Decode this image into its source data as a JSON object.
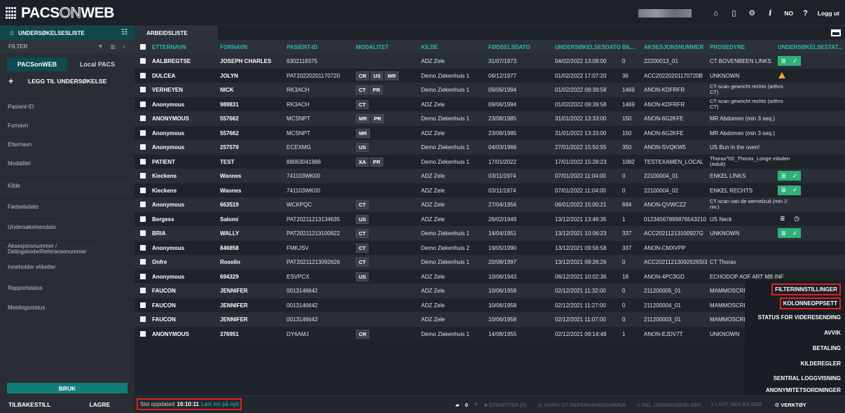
{
  "app": {
    "logo_prefix": "PACS",
    "logo_on": "ON",
    "logo_suffix": "WEB",
    "lang": "NO",
    "help": "?",
    "logout": "Logg ut"
  },
  "tabs": {
    "exam_list": "UNDERSØKELSESLISTE",
    "work_list": "ARBEIDSLISTE"
  },
  "sidebar": {
    "filter_title": "FILTER",
    "source_tabs": [
      "PACSonWEB",
      "Local PACS"
    ],
    "add_exam": "LEGG TIL UNDERSØKELSE",
    "fields": [
      "Pasient-ID",
      "Fornavn",
      "Etternavn",
      "Modalitet",
      "Kilde",
      "Fødselsdato",
      "Undersøkelsesdato",
      "Aksesjonsnummer / Delingskode/Referansenummer",
      "Inneholder etiketter",
      "Rapportstatus",
      "Meldingsstatus"
    ],
    "apply": "BRUK",
    "reset": "TILBAKESTILL",
    "save": "LAGRE"
  },
  "table": {
    "columns": [
      "ETTERNAVN",
      "FORNAVN",
      "PASIENT-ID",
      "MODALITET",
      "KILDE",
      "FØDSELSDATO",
      "UNDERSØKELSESDATO",
      "BIL...",
      "AKSESJONSNUMMER",
      "PROSEDYRE",
      "UNDERSØKELSESTAT..."
    ],
    "rows": [
      {
        "last": "AALBREGTSE",
        "first": "JOSEPH CHARLES",
        "pid": "6302118375",
        "mod": [],
        "src": "ADZ Zele",
        "dob": "31/07/1973",
        "date": "04/02/2022 13:08:00",
        "img": "0",
        "acc": "22200013_01",
        "proc": "CT BOVENBEEN LINKS",
        "status": "green"
      },
      {
        "last": "DULCEA",
        "first": "JOLYN",
        "pid": "PAT20220201170720",
        "mod": [
          "CR",
          "US",
          "MR"
        ],
        "src": "Demo Ziekenhuis 1",
        "dob": "06/12/1977",
        "date": "01/02/2022 17:07:20",
        "img": "36",
        "acc": "ACC20220201170720B",
        "proc": "UNKNOWN",
        "status": "warn"
      },
      {
        "last": "VERHEYEN",
        "first": "NICK",
        "pid": "RK3ACH",
        "mod": [
          "CT",
          "PR"
        ],
        "src": "Demo Ziekenhuis 1",
        "dob": "09/06/1994",
        "date": "01/02/2022 09:39:58",
        "img": "1469",
        "acc": "ANON-KDFRFR",
        "proc": "CT-scan gewricht rechts (arthro CT)",
        "status": ""
      },
      {
        "last": "Anonymous",
        "first": "989831",
        "pid": "RK3ACH",
        "mod": [
          "CT"
        ],
        "src": "ADZ Zele",
        "dob": "09/06/1994",
        "date": "01/02/2022 09:39:58",
        "img": "1469",
        "acc": "ANON-KDFRFR",
        "proc": "CT-scan gewricht rechts (arthro CT)",
        "status": ""
      },
      {
        "last": "ANONYMOUS",
        "first": "557662",
        "pid": "MCSNPT",
        "mod": [
          "MR",
          "PR"
        ],
        "src": "Demo Ziekenhuis 1",
        "dob": "23/08/1985",
        "date": "31/01/2022 13:33:00",
        "img": "150",
        "acc": "ANON-6G2KFE",
        "proc": "MR Abdomen (min 3 seq.)",
        "status": ""
      },
      {
        "last": "Anonymous",
        "first": "557662",
        "pid": "MCSNPT",
        "mod": [
          "MR"
        ],
        "src": "ADZ Zele",
        "dob": "23/08/1985",
        "date": "31/01/2022 13:33:00",
        "img": "150",
        "acc": "ANON-6G2KFE",
        "proc": "MR Abdomen (min 3 seq.)",
        "status": ""
      },
      {
        "last": "Anonymous",
        "first": "257579",
        "pid": "ECEXMG",
        "mod": [
          "US"
        ],
        "src": "Demo Ziekenhuis 1",
        "dob": "04/03/1966",
        "date": "27/01/2022 15:50:55",
        "img": "350",
        "acc": "ANON-SVQKW5",
        "proc": "US Bun in the oven!",
        "status": ""
      },
      {
        "last": "PATIENT",
        "first": "TEST",
        "pid": "88063041986",
        "mod": [
          "XA",
          "PR"
        ],
        "src": "Demo Ziekenhuis 1",
        "dob": "17/01/2022",
        "date": "17/01/2022 15:28:23",
        "img": "1082",
        "acc": "TESTEXAMEN_LOCAL",
        "proc": "Thorax^02_Thorax_Longe mbolen (Adult)",
        "status": ""
      },
      {
        "last": "Kieckens",
        "first": "Wannes",
        "pid": "741103WK00",
        "mod": [],
        "src": "ADZ Zele",
        "dob": "03/11/1974",
        "date": "07/01/2022 11:04:00",
        "img": "0",
        "acc": "22100004_01",
        "proc": "ENKEL LINKS",
        "status": "green"
      },
      {
        "last": "Kieckens",
        "first": "Wannes",
        "pid": "741103WK00",
        "mod": [],
        "src": "ADZ Zele",
        "dob": "03/11/1974",
        "date": "07/01/2022 11:04:00",
        "img": "0",
        "acc": "22100004_02",
        "proc": "ENKEL RECHTS",
        "status": "green"
      },
      {
        "last": "Anonymous",
        "first": "663519",
        "pid": "WCKPQC",
        "mod": [
          "CT"
        ],
        "src": "ADZ Zele",
        "dob": "27/04/1956",
        "date": "06/01/2022 15:00:21",
        "img": "694",
        "acc": "ANON-QVWCZZ",
        "proc": "CT-scan van de wervelzuil (min 2 niv.)",
        "status": ""
      },
      {
        "last": "Bergess",
        "first": "Salomi",
        "pid": "PAT20211213134635",
        "mod": [
          "US"
        ],
        "src": "ADZ Zele",
        "dob": "26/02/1949",
        "date": "13/12/2021 13:46:35",
        "img": "1",
        "acc": "01234567899876543210",
        "proc": "US Neck",
        "status": "gray"
      },
      {
        "last": "BRIA",
        "first": "WALLY",
        "pid": "PAT20211213100622",
        "mod": [
          "CT"
        ],
        "src": "Demo Ziekenhuis 1",
        "dob": "14/04/1951",
        "date": "13/12/2021 10:06:23",
        "img": "337",
        "acc": "ACC20211213100927G",
        "proc": "UNKNOWN",
        "status": "green"
      },
      {
        "last": "Anonymous",
        "first": "846858",
        "pid": "FMKJSV",
        "mod": [
          "CT"
        ],
        "src": "Demo Ziekenhuis 2",
        "dob": "19/05/1990",
        "date": "13/12/2021 09:56:58",
        "img": "337",
        "acc": "ANON-CMXVPP",
        "proc": "",
        "status": ""
      },
      {
        "last": "Onfre",
        "first": "Roselin",
        "pid": "PAT20211213092626",
        "mod": [
          "CT"
        ],
        "src": "Demo Ziekenhuis 1",
        "dob": "20/08/1997",
        "date": "13/12/2021 09:26:26",
        "img": "0",
        "acc": "ACC20211213092626SI3",
        "proc": "CT Thorax",
        "status": ""
      },
      {
        "last": "Anonymous",
        "first": "694329",
        "pid": "ESVPCX",
        "mod": [
          "US"
        ],
        "src": "ADZ Zele",
        "dob": "10/06/1943",
        "date": "06/12/2021 10:02:36",
        "img": "18",
        "acc": "ANON-4PC3GD",
        "proc": "ECHODOP AOF ART MB INF",
        "status": ""
      },
      {
        "last": "FAUCON",
        "first": "JENNIFER",
        "pid": "0013146642",
        "mod": [],
        "src": "ADZ Zele",
        "dob": "10/06/1958",
        "date": "02/12/2021 11:32:00",
        "img": "0",
        "acc": "211200005_01",
        "proc": "MAMMOSCREI LEZING",
        "status": ""
      },
      {
        "last": "FAUCON",
        "first": "JENNIFER",
        "pid": "0013146642",
        "mod": [],
        "src": "ADZ Zele",
        "dob": "10/06/1958",
        "date": "02/12/2021 11:27:00",
        "img": "0",
        "acc": "211200004_01",
        "proc": "MAMMOSCREI LEZING",
        "status": ""
      },
      {
        "last": "FAUCON",
        "first": "JENNIFER",
        "pid": "0013146642",
        "mod": [],
        "src": "ADZ Zele",
        "dob": "10/06/1958",
        "date": "02/12/2021 11:07:00",
        "img": "0",
        "acc": "211200003_01",
        "proc": "MAMMOSCREI LEZING",
        "status": ""
      },
      {
        "last": "ANONYMOUS",
        "first": "376951",
        "pid": "DY6AMJ",
        "mod": [
          "CR"
        ],
        "src": "Demo Ziekenhuis 1",
        "dob": "14/08/1955",
        "date": "02/12/2021 09:14:48",
        "img": "1",
        "acc": "ANON-EJDV7T",
        "proc": "UNKNOWN",
        "status": ""
      }
    ]
  },
  "footer": {
    "last_updated_label": "Sist oppdatert",
    "last_updated_time": "16:10:11",
    "reload": "Last inn på nytt",
    "folder_count": "0",
    "labels": "ETIKETTER (0)",
    "print_ref": "SKRIV UT REFERANSENUMMER",
    "share": "DEL UNDERSØKELSER",
    "download": "LAST NED BILDER",
    "tools": "VERKTØY"
  },
  "context_menu": {
    "items": [
      "FILTERINNSTILLINGER",
      "KOLONNEOPPSETT",
      "STATUS FOR VIDERESENDING",
      "AVVIK",
      "BETALING",
      "KILDEREGLER",
      "SENTRAL LOGGVISNING",
      "ANONYMITETSORDNINGER"
    ]
  }
}
